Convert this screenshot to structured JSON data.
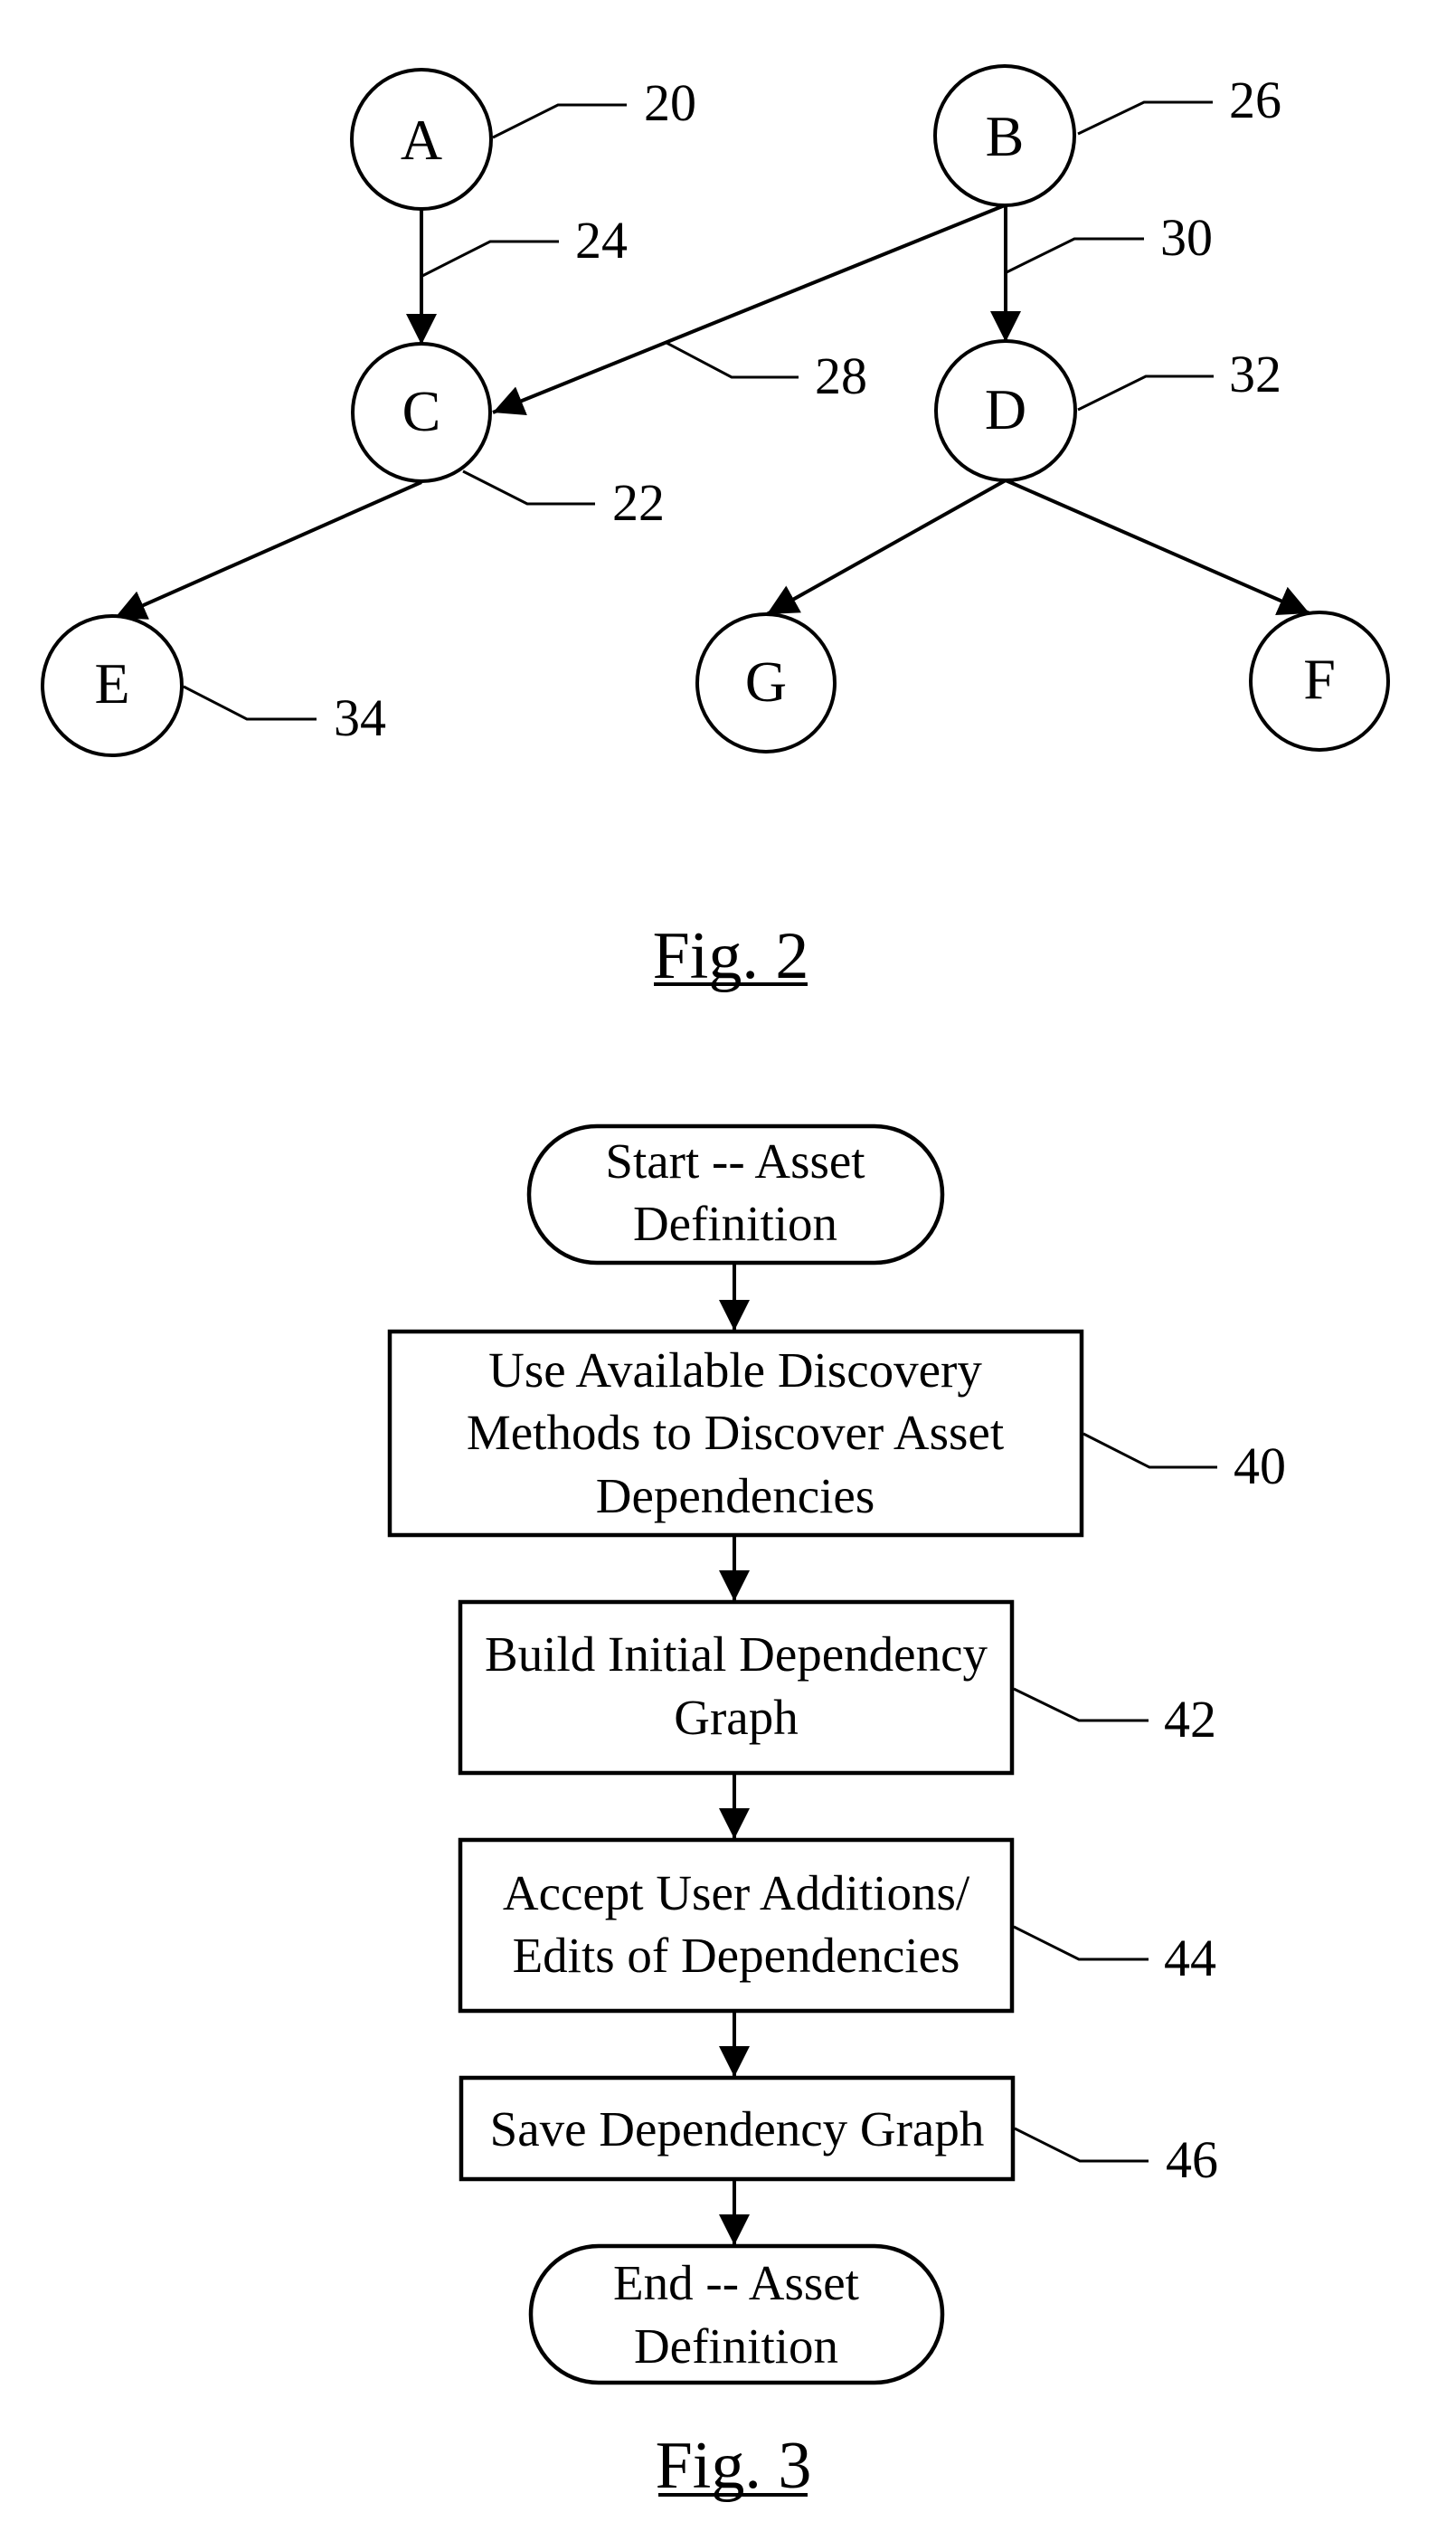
{
  "figure2": {
    "caption": "Fig. 2",
    "nodes": {
      "A": {
        "label": "A",
        "ref": "20"
      },
      "B": {
        "label": "B",
        "ref": "26"
      },
      "C": {
        "label": "C",
        "ref": "22"
      },
      "D": {
        "label": "D",
        "ref": "32"
      },
      "E": {
        "label": "E",
        "ref": "34"
      },
      "F": {
        "label": "F"
      },
      "G": {
        "label": "G"
      }
    },
    "edges": [
      {
        "from": "A",
        "to": "C",
        "ref": "24"
      },
      {
        "from": "B",
        "to": "C",
        "ref": "28"
      },
      {
        "from": "B",
        "to": "D",
        "ref": "30"
      },
      {
        "from": "C",
        "to": "E"
      },
      {
        "from": "D",
        "to": "G"
      },
      {
        "from": "D",
        "to": "F"
      }
    ]
  },
  "figure3": {
    "caption": "Fig. 3",
    "start": {
      "lines": [
        "Start -- Asset",
        "Definition"
      ]
    },
    "steps": [
      {
        "ref": "40",
        "lines": [
          "Use Available Discovery",
          "Methods to Discover Asset",
          "Dependencies"
        ]
      },
      {
        "ref": "42",
        "lines": [
          "Build Initial Dependency",
          "Graph"
        ]
      },
      {
        "ref": "44",
        "lines": [
          "Accept User Additions/",
          "Edits of Dependencies"
        ]
      },
      {
        "ref": "46",
        "lines": [
          "Save Dependency Graph"
        ]
      }
    ],
    "end": {
      "lines": [
        "End -- Asset",
        "Definition"
      ]
    }
  }
}
